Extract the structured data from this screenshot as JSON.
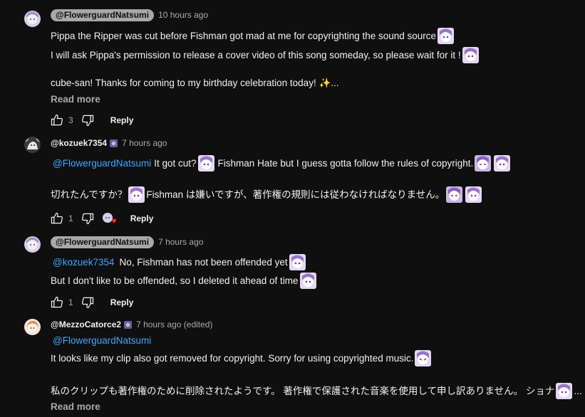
{
  "comments": [
    {
      "handle": "@FlowerguardNatsumi",
      "time": "10 hours ago",
      "lines": [
        "Pippa the Ripper was cut before Fishman got mad at me for copyrighting the sound source",
        "I will ask Pippa's permission to release a cover video of this song someday, so please wait for it !",
        "cube-san! Thanks for coming to my birthday celebration today! ✨..."
      ],
      "read_more": "Read more",
      "likes": "3",
      "reply": "Reply"
    },
    {
      "handle": "@kozuek7354",
      "time": "7 hours ago",
      "mention": "@FlowerguardNatsumi",
      "line1": "It got cut?",
      "line1b": "Fishman Hate but I guess gotta follow the rules of copyright.",
      "line2a": "切れたんですか？",
      "line2b": "Fishman は嫌いですが、著作権の規則には従わなければなりません。",
      "likes": "1",
      "reply": "Reply"
    },
    {
      "handle": "@FlowerguardNatsumi",
      "time": "7 hours ago",
      "mention": "@kozuek7354",
      "line1": "No, Fishman has not been offended yet",
      "line2": "But I don't like to be offended, so I deleted it ahead of time",
      "likes": "1",
      "reply": "Reply"
    },
    {
      "handle": "@MezzoCatorce2",
      "time": "7 hours ago (edited)",
      "mention": "@FlowerguardNatsumi",
      "line1": "It looks like my clip also got removed for copyright. Sorry for using copyrighted music.",
      "line2": "私のクリップも著作権のために削除されたようです。 著作権で保護された音楽を使用して申し訳ありません。 ショナ",
      "read_more": "Read more"
    }
  ],
  "colors": {
    "background": "#0f0f0f",
    "link": "#3ea6ff",
    "muted": "#aaaaaa",
    "pill": "#a8a8a8"
  }
}
